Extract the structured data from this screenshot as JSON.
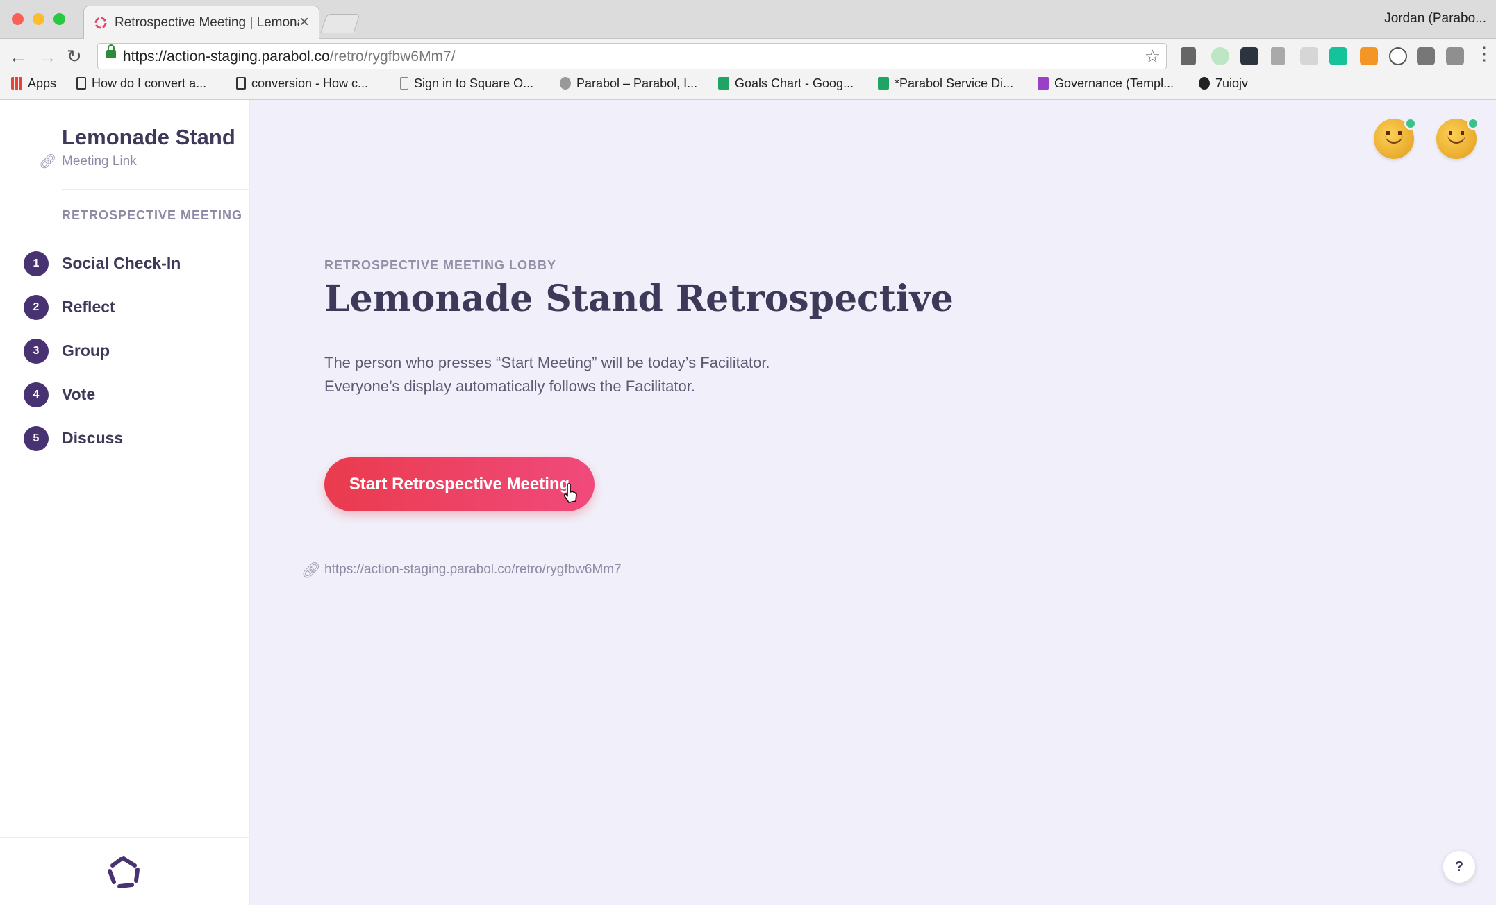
{
  "browser": {
    "tab_title": "Retrospective Meeting | Lemonade Stand",
    "profile": "Jordan (Parabo...",
    "url_host": "https://action-staging.parabol.co",
    "url_path": "/retro/rygfbw6Mm7/",
    "bookmarks": [
      {
        "label": "Apps",
        "icon": "apps-grid-icon"
      },
      {
        "label": "How do I convert a...",
        "icon": "bookmark-icon"
      },
      {
        "label": "conversion - How c...",
        "icon": "bookmark-icon"
      },
      {
        "label": "Sign in to Square O...",
        "icon": "page-icon"
      },
      {
        "label": "Parabol – Parabol, I...",
        "icon": "bird-icon"
      },
      {
        "label": "Goals Chart - Goog...",
        "icon": "sheets-icon"
      },
      {
        "label": "*Parabol Service Di...",
        "icon": "sheets-icon"
      },
      {
        "label": "Governance (Templ...",
        "icon": "board-icon"
      },
      {
        "label": "7uiojv",
        "icon": "github-icon"
      }
    ]
  },
  "sidebar": {
    "team_name": "Lemonade Stand",
    "meeting_link": "Meeting Link",
    "section_label": "RETROSPECTIVE MEETING",
    "phases": [
      {
        "num": "1",
        "label": "Social Check-In"
      },
      {
        "num": "2",
        "label": "Reflect"
      },
      {
        "num": "3",
        "label": "Group"
      },
      {
        "num": "4",
        "label": "Vote"
      },
      {
        "num": "5",
        "label": "Discuss"
      }
    ]
  },
  "lobby": {
    "eyebrow": "RETROSPECTIVE MEETING LOBBY",
    "title": "Lemonade Stand Retrospective",
    "description_line1": "The person who presses “Start Meeting” will be today’s Facilitator.",
    "description_line2": "Everyone’s display automatically follows the Facilitator.",
    "start_button": "Start Retrospective Meeting",
    "meeting_url": "https://action-staging.parabol.co/retro/rygfbw6Mm7"
  },
  "help": "?",
  "colors": {
    "brand_purple": "#493272",
    "start_gradient_from": "#ea3b4d",
    "start_gradient_to": "#f04a7c",
    "presence_green": "#39c38a"
  }
}
